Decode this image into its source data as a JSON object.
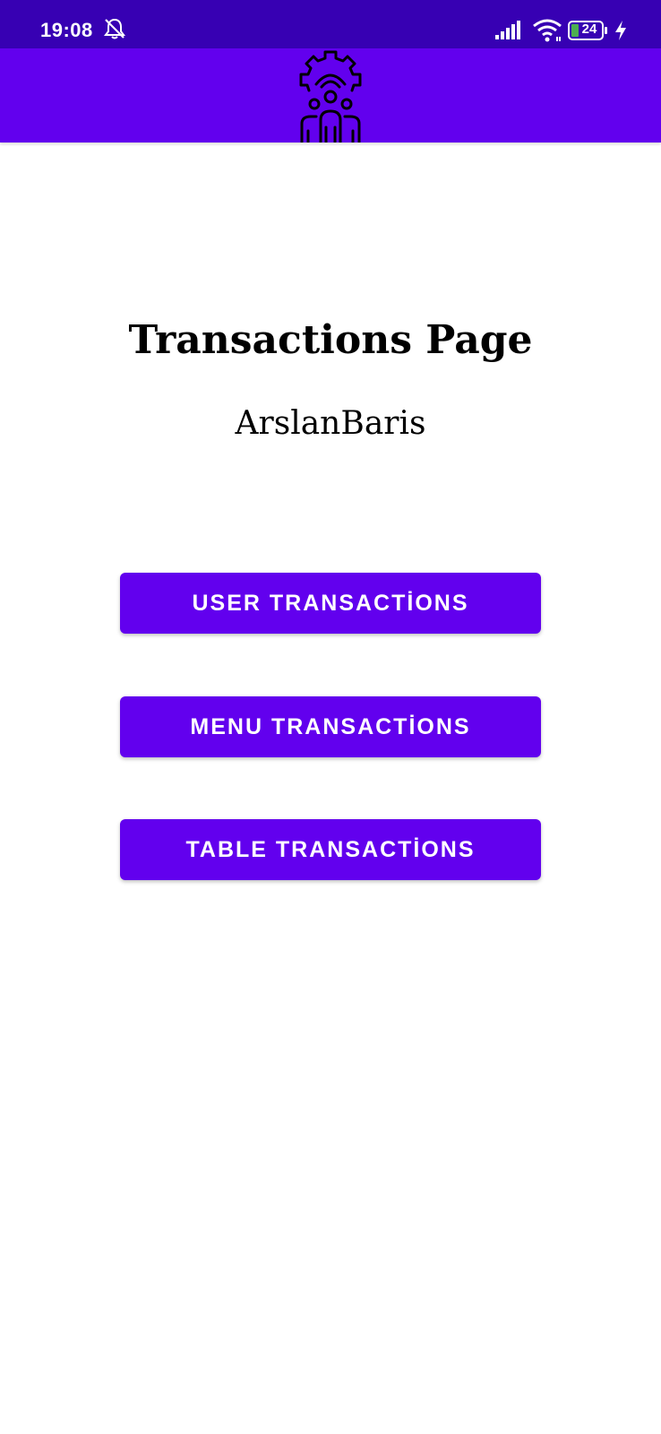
{
  "status_bar": {
    "time": "19:08",
    "battery_level": "24",
    "icons": [
      "bell-off-icon",
      "signal-icon",
      "wifi-icon",
      "battery-icon",
      "charging-icon"
    ],
    "background_color": "#3700B3"
  },
  "app_bar": {
    "logo_icon": "gear-people-logo-icon",
    "background_color": "#6200EE"
  },
  "main": {
    "title": "Transactions Page",
    "user_name": "ArslanBaris",
    "buttons": [
      {
        "label": "USER TRANSACTİONS"
      },
      {
        "label": "MENU TRANSACTİONS"
      },
      {
        "label": "TABLE TRANSACTİONS"
      }
    ],
    "button_color": "#6200EE"
  }
}
